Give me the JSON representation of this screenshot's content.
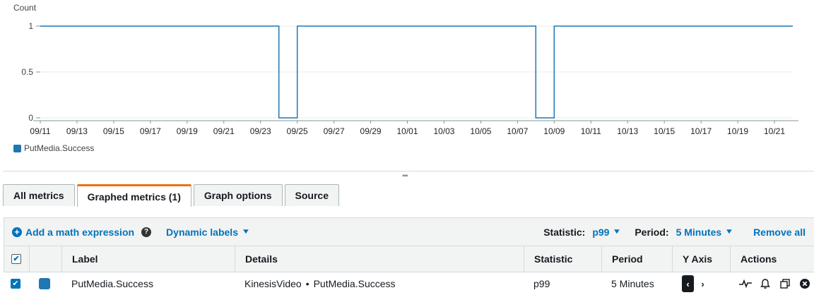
{
  "chart_data": {
    "type": "line",
    "ylabel": "Count",
    "ylim": [
      0,
      1
    ],
    "yticks": [
      "1",
      "0.5",
      "0"
    ],
    "x_tick_labels": [
      "09/11",
      "09/13",
      "09/15",
      "09/17",
      "09/19",
      "09/21",
      "09/23",
      "09/25",
      "09/27",
      "09/29",
      "10/01",
      "10/03",
      "10/05",
      "10/07",
      "10/09",
      "10/11",
      "10/13",
      "10/15",
      "10/17",
      "10/19",
      "10/21"
    ],
    "x_start": "09/11",
    "x_end": "10/22",
    "series": [
      {
        "name": "PutMedia.Success",
        "color": "#1f77b4",
        "points": [
          {
            "x": "09/11 00:00",
            "y": 1
          },
          {
            "x": "09/24 00:00",
            "y": 1
          },
          {
            "x": "09/24 00:00",
            "y": 0
          },
          {
            "x": "09/25 00:00",
            "y": 0
          },
          {
            "x": "09/25 00:00",
            "y": 1
          },
          {
            "x": "10/08 00:00",
            "y": 1
          },
          {
            "x": "10/08 00:00",
            "y": 0
          },
          {
            "x": "10/09 00:00",
            "y": 0
          },
          {
            "x": "10/09 00:00",
            "y": 1
          },
          {
            "x": "10/22 00:00",
            "y": 1
          }
        ]
      }
    ]
  },
  "legend": {
    "label": "PutMedia.Success",
    "color": "#1f77b4"
  },
  "tabs": [
    {
      "label": "All metrics",
      "active": false
    },
    {
      "label": "Graphed metrics (1)",
      "active": true
    },
    {
      "label": "Graph options",
      "active": false
    },
    {
      "label": "Source",
      "active": false
    }
  ],
  "toolbar": {
    "add_expression": "Add a math expression",
    "help_icon": "?",
    "dynamic_labels": "Dynamic labels",
    "statistic_label": "Statistic:",
    "statistic_value": "p99",
    "period_label": "Period:",
    "period_value": "5 Minutes",
    "remove_all": "Remove all"
  },
  "table": {
    "headers": {
      "label": "Label",
      "details": "Details",
      "statistic": "Statistic",
      "period": "Period",
      "y_axis": "Y Axis",
      "actions": "Actions"
    },
    "rows": [
      {
        "checked": true,
        "color": "#1f77b4",
        "label": "PutMedia.Success",
        "details_namespace": "KinesisVideo",
        "details_separator": "•",
        "details_metric": "PutMedia.Success",
        "statistic": "p99",
        "period": "5 Minutes",
        "y_axis": "left"
      }
    ]
  },
  "colors": {
    "accent": "#0073bb",
    "tab_active": "#ec7211",
    "series": "#1f77b4"
  }
}
